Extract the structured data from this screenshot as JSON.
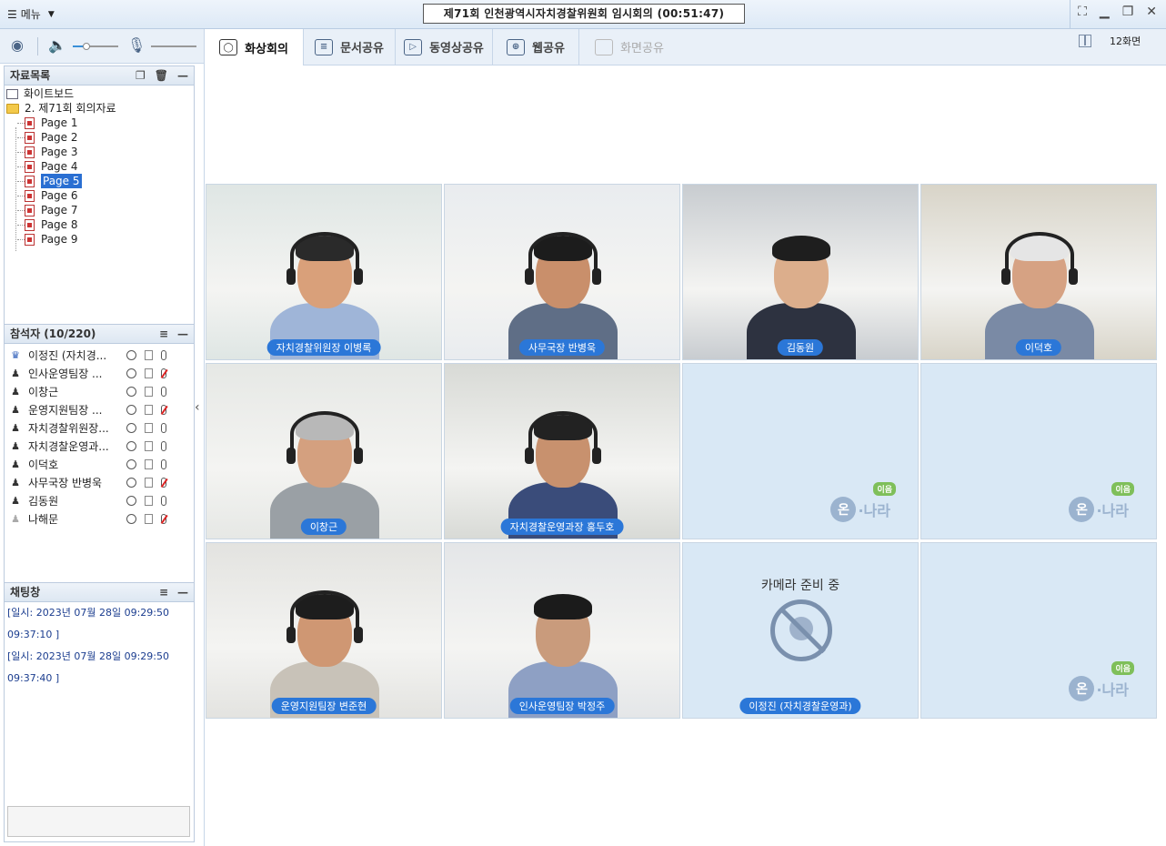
{
  "titlebar": {
    "menu_label": "메뉴",
    "title": "제71회 인천광역시자치경찰위원회 임시회의  (00:51:47)"
  },
  "toolbar": {
    "volume_level": 0.3,
    "mic_level": 0.0
  },
  "tabs": [
    {
      "label": "화상회의",
      "icon": "person-icon",
      "active": true,
      "disabled": false
    },
    {
      "label": "문서공유",
      "icon": "document-icon",
      "active": false,
      "disabled": false
    },
    {
      "label": "동영상공유",
      "icon": "play-icon",
      "active": false,
      "disabled": false
    },
    {
      "label": "웹공유",
      "icon": "globe-icon",
      "active": false,
      "disabled": false
    },
    {
      "label": "화면공유",
      "icon": "screen-icon",
      "active": false,
      "disabled": true
    }
  ],
  "screen_count_label": "12화면",
  "materials": {
    "header": "자료목록",
    "whiteboard": "화이트보드",
    "folder": "2. 제71회 회의자료",
    "pages": [
      "Page 1",
      "Page 2",
      "Page 3",
      "Page 4",
      "Page 5",
      "Page 6",
      "Page 7",
      "Page 8",
      "Page 9"
    ],
    "selected_page": "Page 5"
  },
  "participants": {
    "header": "참석자 (10/220)",
    "items": [
      {
        "name": "이정진 (자치경...",
        "role": "host",
        "mic": "on"
      },
      {
        "name": "인사운영팀장 ...",
        "role": "member",
        "mic": "off"
      },
      {
        "name": "이창근",
        "role": "member",
        "mic": "on"
      },
      {
        "name": "운영지원팀장 ...",
        "role": "member",
        "mic": "off"
      },
      {
        "name": "자치경찰위원장...",
        "role": "member",
        "mic": "on"
      },
      {
        "name": "자치경찰운영과...",
        "role": "member",
        "mic": "on"
      },
      {
        "name": "이덕호",
        "role": "member",
        "mic": "on"
      },
      {
        "name": "사무국장 반병욱",
        "role": "member",
        "mic": "off"
      },
      {
        "name": "김동원",
        "role": "member",
        "mic": "on"
      },
      {
        "name": "나해문",
        "role": "guest",
        "mic": "off"
      }
    ]
  },
  "chat": {
    "header": "채팅창",
    "lines": [
      "[일시: 2023년 07월 28일 09:29:50",
      "09:37:10 ]",
      "[일시: 2023년 07월 28일 09:29:50",
      "09:37:40 ]"
    ]
  },
  "videos": [
    {
      "name": "자치경찰위원장 이병록",
      "bg": "#dfe6e4",
      "shirt": "#9fb5d8",
      "skin": "#d9a07a",
      "hair": "#2a2a2a",
      "headset": true
    },
    {
      "name": "사무국장 반병욱",
      "bg": "#e9ecef",
      "shirt": "#5f6e86",
      "skin": "#c98f6b",
      "hair": "#1c1c1c",
      "headset": true
    },
    {
      "name": "김동원",
      "bg": "#c8ccd0",
      "shirt": "#2d3240",
      "skin": "#dcae8c",
      "hair": "#1e1e1e",
      "headset": false
    },
    {
      "name": "이덕호",
      "bg": "#d8d4c8",
      "shirt": "#7a8aa5",
      "skin": "#d6a283",
      "hair": "#e5e5e5",
      "headset": true
    },
    {
      "name": "이창근",
      "bg": "#e6e8e5",
      "shirt": "#9aa0a5",
      "skin": "#d4a07f",
      "hair": "#b8b8b8",
      "headset": true
    },
    {
      "name": "자치경찰운영과장 홍두호",
      "bg": "#d8dad6",
      "shirt": "#3a4c7a",
      "skin": "#c8916e",
      "hair": "#222",
      "headset": true
    },
    {
      "name": "",
      "empty": true
    },
    {
      "name": "",
      "empty": true
    },
    {
      "name": "운영지원팀장 변준현",
      "bg": "#e3e3e0",
      "shirt": "#c8c2b8",
      "skin": "#cf9773",
      "hair": "#1d1d1d",
      "headset": true
    },
    {
      "name": "인사운영팀장 박정주",
      "bg": "#e4e6e8",
      "shirt": "#8ea0c4",
      "skin": "#c99b7c",
      "hair": "#1b1b1b",
      "headset": false
    },
    {
      "name": "이정진 (자치경찰운영과)",
      "camera_prep": true
    },
    {
      "name": "",
      "empty": true
    }
  ],
  "camera_prep_label": "카메라 준비 중",
  "logo": {
    "on": "온",
    "text": "·나라",
    "badge": "이음"
  }
}
